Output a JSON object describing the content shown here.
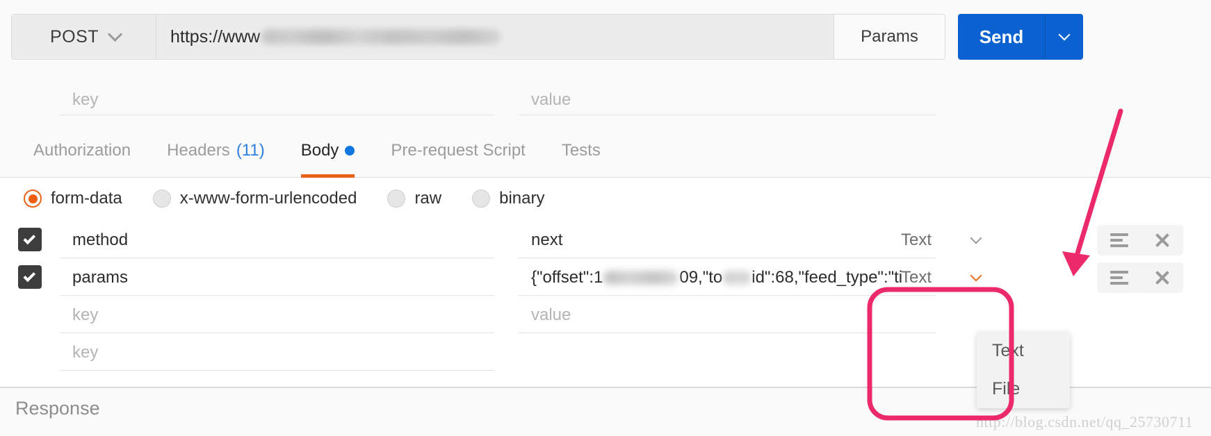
{
  "request_bar": {
    "method": "POST",
    "method_caret_icon": "chevron-down-icon",
    "url_prefix": "https://www",
    "url_redacted": true,
    "params_label": "Params",
    "send_label": "Send",
    "send_caret_icon": "chevron-down-icon"
  },
  "top_kv_row": {
    "key_placeholder": "key",
    "value_placeholder": "value"
  },
  "tabs": [
    {
      "label": "Authorization",
      "active": false,
      "count": "",
      "dot": false
    },
    {
      "label": "Headers",
      "active": false,
      "count": "(11)",
      "dot": false
    },
    {
      "label": "Body",
      "active": true,
      "count": "",
      "dot": true
    },
    {
      "label": "Pre-request Script",
      "active": false,
      "count": "",
      "dot": false
    },
    {
      "label": "Tests",
      "active": false,
      "count": "",
      "dot": false
    }
  ],
  "body_types": [
    {
      "label": "form-data",
      "selected": true
    },
    {
      "label": "x-www-form-urlencoded",
      "selected": false
    },
    {
      "label": "raw",
      "selected": false
    },
    {
      "label": "binary",
      "selected": false
    }
  ],
  "form_data_rows": [
    {
      "checked": true,
      "key": "method",
      "value": "next",
      "value_redacted": false,
      "type": "Text",
      "type_caret_active": false,
      "menu_icon": "hamburger-icon",
      "delete_icon": "close-icon"
    },
    {
      "checked": true,
      "key": "params",
      "value_prefix": "{\"offset\":1",
      "value_mid": "09,\"to",
      "value_suffix": "id\":68,\"feed_type\":\"ti",
      "value_redacted": true,
      "type": "Text",
      "type_caret_active": true,
      "menu_icon": "hamburger-icon",
      "delete_icon": "close-icon"
    }
  ],
  "form_data_empty_row": {
    "key_placeholder": "key",
    "value_placeholder": "value"
  },
  "type_dropdown": {
    "open": true,
    "options": [
      "Text",
      "File"
    ]
  },
  "response": {
    "title": "Response"
  },
  "annotations": {
    "highlight_color": "#ec2a6b",
    "arrow_color": "#ec2a6b",
    "watermark": "http://blog.csdn.net/qq_25730711"
  },
  "colors": {
    "send_blue": "#0a62d0",
    "accent_orange": "#e8631a",
    "tab_count_blue": "#2f7fe0",
    "body_dot_blue": "#1177e0",
    "checkbox_dark": "#3d3d3d"
  }
}
